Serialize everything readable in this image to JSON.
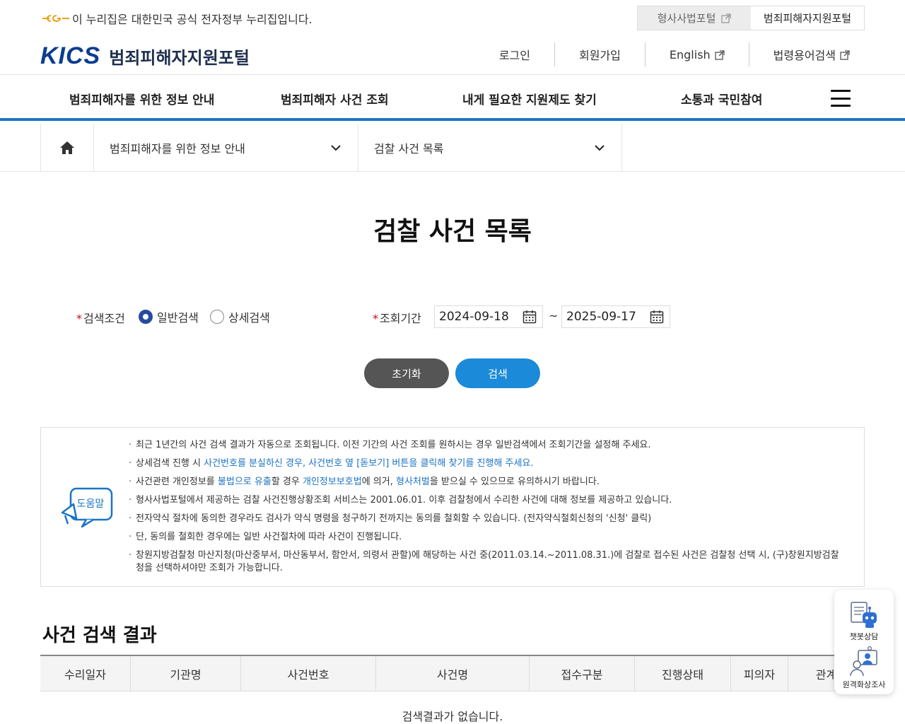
{
  "gov_banner": {
    "text": "이 누리집은 대한민국 공식 전자정부 누리집입니다.",
    "links": [
      {
        "label": "형사사법포털"
      },
      {
        "label": "범죄피해자지원포털"
      }
    ]
  },
  "header": {
    "logo_mark": "KICS",
    "logo_text": "범죄피해자지원포털",
    "util_nav": [
      {
        "label": "로그인"
      },
      {
        "label": "회원가입"
      },
      {
        "label": "English"
      },
      {
        "label": "법령용어검색"
      }
    ]
  },
  "gnb": {
    "items": [
      {
        "label": "범죄피해자를 위한 정보 안내"
      },
      {
        "label": "범죄피해자 사건 조회"
      },
      {
        "label": "내게 필요한 지원제도 찾기"
      },
      {
        "label": "소통과 국민참여"
      }
    ]
  },
  "breadcrumb": {
    "level1": "범죄피해자를 위한 정보 안내",
    "level2": "검찰 사건 목록"
  },
  "page_title": "검찰 사건 목록",
  "search": {
    "cond_label": "검색조건",
    "required_mark": "*",
    "options": [
      {
        "label": "일반검색",
        "checked": true
      },
      {
        "label": "상세검색",
        "checked": false
      }
    ],
    "period_label": "조회기간",
    "date_from": "2024-09-18",
    "date_to": "2025-09-17",
    "tilde": "~",
    "reset_label": "초기화",
    "search_label": "검색"
  },
  "help": {
    "icon_label": "도움말",
    "items": [
      {
        "segments": [
          {
            "t": "최근 1년간의 사건 검색 결과가 자동으로 조회됩니다. 이전 기간의 사건 조회를 원하시는 경우 일반검색에서 조회기간을 설정해 주세요."
          }
        ]
      },
      {
        "segments": [
          {
            "t": "상세검색 진행 시 "
          },
          {
            "t": "사건번호를 분실하신 경우, 사건번호 옆 [돋보기] 버튼을 클릭해 찾기를 진행해 주세요.",
            "hl": true
          }
        ]
      },
      {
        "segments": [
          {
            "t": "사건관련 개인정보를 "
          },
          {
            "t": "불법으로 유출",
            "hl": true
          },
          {
            "t": "할 경우 "
          },
          {
            "t": "개인정보보호법",
            "hl": true
          },
          {
            "t": "에 의거, "
          },
          {
            "t": "형사처벌",
            "hl": true
          },
          {
            "t": "을 받으실 수 있으므로 유의하시기 바랍니다."
          }
        ]
      },
      {
        "segments": [
          {
            "t": "형사사법포털에서 제공하는 검찰 사건진행상황조회 서비스는 2001.06.01. 이후 검찰청에서 수리한 사건에 대해 정보를 제공하고 있습니다."
          }
        ]
      },
      {
        "segments": [
          {
            "t": "전자약식 절차에 동의한 경우라도 검사가 약식 명령을 청구하기 전까지는 동의를 철회할 수 있습니다. (전자약식철회신청의 '신청' 클릭)"
          }
        ]
      },
      {
        "segments": [
          {
            "t": "단, 동의를 철회한 경우에는 일반 사건절차에 따라 사건이 진행됩니다."
          }
        ]
      },
      {
        "segments": [
          {
            "t": "창원지방검찰청 마산지청(마산중부서, 마산동부서, 함안서, 의령서 관할)에 해당하는 사건 중(2011.03.14.~2011.08.31.)에 검찰로 접수된 사건은 검찰청 선택 시, (구)창원지방검찰청을 선택하셔야만 조회가 가능합니다."
          }
        ]
      }
    ]
  },
  "results": {
    "title": "사건 검색 결과",
    "columns": [
      "수리일자",
      "기관명",
      "사건번호",
      "사건명",
      "접수구분",
      "진행상태",
      "피의자",
      "관계"
    ],
    "empty_text": "검색결과가 없습니다."
  },
  "float_panel": {
    "items": [
      {
        "label": "챗봇상담",
        "icon": "chatbot-icon"
      },
      {
        "label": "원격화상조사",
        "icon": "video-call-icon"
      }
    ]
  },
  "colors": {
    "primary": "#1b74c4",
    "button_blue": "#1b8ad8",
    "button_gray": "#555555",
    "radio_checked": "#264b9e",
    "required": "#d0021b"
  }
}
